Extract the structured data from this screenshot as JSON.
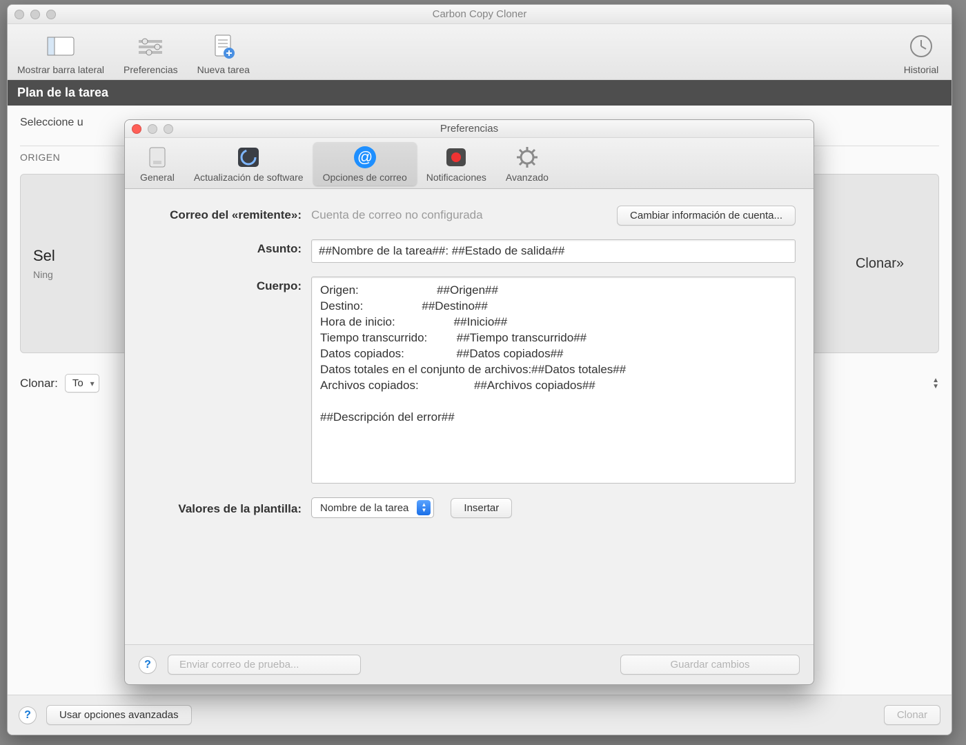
{
  "main": {
    "title": "Carbon Copy Cloner",
    "toolbar": {
      "show_sidebar": "Mostrar barra lateral",
      "preferences": "Preferencias",
      "new_task": "Nueva tarea",
      "history": "Historial"
    },
    "tab": "Plan de la tarea",
    "select_hint": "Seleccione u",
    "origin_label": "ORIGEN",
    "src_big": "Sel",
    "src_small": "Ning",
    "src_side": "Clonar»",
    "clonar_label": "Clonar:",
    "clonar_value": "To",
    "advanced_btn": "Usar opciones avanzadas",
    "clone_btn": "Clonar"
  },
  "prefs": {
    "title": "Preferencias",
    "tabs": {
      "general": "General",
      "software_update": "Actualización de software",
      "mail": "Opciones de correo",
      "notifications": "Notificaciones",
      "advanced": "Avanzado"
    },
    "sender_label": "Correo del «remitente»:",
    "sender_value": "Cuenta de correo no configurada",
    "change_account_btn": "Cambiar información de cuenta...",
    "subject_label": "Asunto:",
    "subject_value": "##Nombre de la tarea##: ##Estado de salida##",
    "body_label": "Cuerpo:",
    "body_value": "Origen:                        ##Origen##\nDestino:                  ##Destino##\nHora de inicio:                  ##Inicio##\nTiempo transcurrido:         ##Tiempo transcurrido##\nDatos copiados:                ##Datos copiados##\nDatos totales en el conjunto de archivos:##Datos totales##\nArchivos copiados:                 ##Archivos copiados##\n\n##Descripción del error##",
    "template_label": "Valores de la plantilla:",
    "template_value": "Nombre de la tarea",
    "insert_btn": "Insertar",
    "send_test_btn": "Enviar correo de prueba...",
    "save_btn": "Guardar cambios"
  }
}
